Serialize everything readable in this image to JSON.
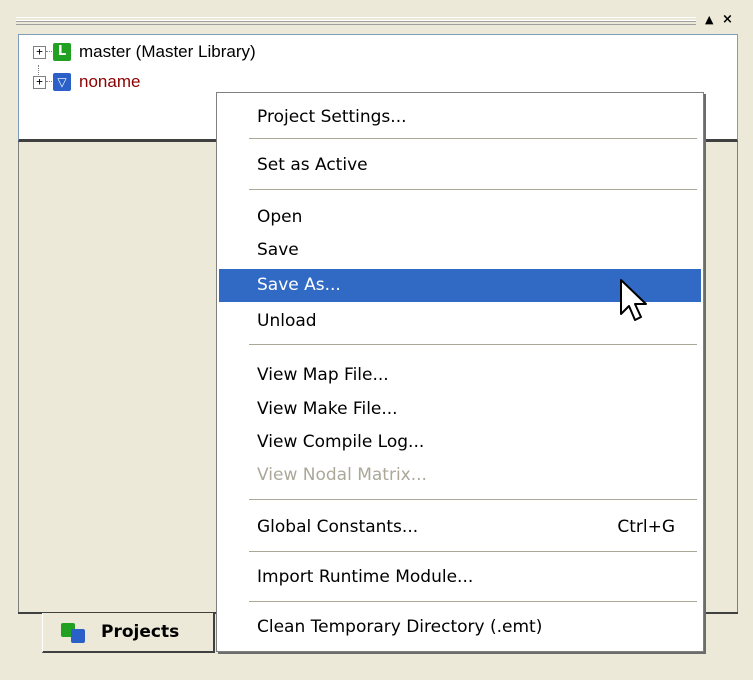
{
  "panel": {
    "tree": [
      {
        "label": "master (Master Library)",
        "icon": "L"
      },
      {
        "label": "noname",
        "icon": "project"
      }
    ],
    "tab_label": "Projects",
    "btn_up": "▲",
    "btn_close": "×"
  },
  "menu": {
    "items": [
      {
        "label": "Project Settings..."
      },
      {
        "label": "Set as Active"
      },
      {
        "label": "Open"
      },
      {
        "label": "Save"
      },
      {
        "label": "Save As..."
      },
      {
        "label": "Unload"
      },
      {
        "label": "View Map File..."
      },
      {
        "label": "View Make File..."
      },
      {
        "label": "View Compile Log..."
      },
      {
        "label": "View Nodal Matrix..."
      },
      {
        "label": "Global Constants...",
        "shortcut": "Ctrl+G"
      },
      {
        "label": "Import Runtime Module..."
      },
      {
        "label": "Clean Temporary Directory (.emt)"
      }
    ]
  },
  "colors": {
    "selection": "#316ac5",
    "disabled": "#aca899",
    "window": "#ece9d8"
  }
}
